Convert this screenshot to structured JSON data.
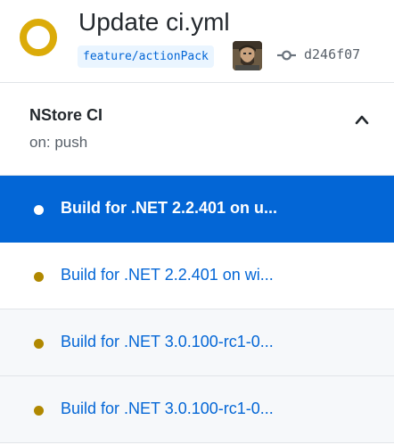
{
  "run": {
    "title": "Update ci.yml",
    "status": "in-progress",
    "status_color": "#dbab09",
    "branch": "feature/actionPack",
    "commit_sha": "d246f07",
    "icons": {
      "status": "status-ring-icon",
      "commit": "git-commit-icon",
      "avatar": "user-avatar"
    }
  },
  "workflow": {
    "name": "NStore CI",
    "trigger": "on: push",
    "expanded": true,
    "icon": "chevron-up-icon"
  },
  "jobs": [
    {
      "label": "Build for .NET 2.2.401 on u...",
      "selected": true,
      "status_color": "#b08800"
    },
    {
      "label": "Build for .NET 2.2.401 on wi...",
      "selected": false,
      "status_color": "#b08800"
    },
    {
      "label": "Build for .NET 3.0.100-rc1-0...",
      "selected": false,
      "status_color": "#b08800"
    },
    {
      "label": "Build for .NET 3.0.100-rc1-0...",
      "selected": false,
      "status_color": "#b08800"
    }
  ],
  "colors": {
    "accent": "#0366d6",
    "branch_bg": "#eaf5ff",
    "in_progress": "#dbab09",
    "border": "#e1e4e8"
  }
}
